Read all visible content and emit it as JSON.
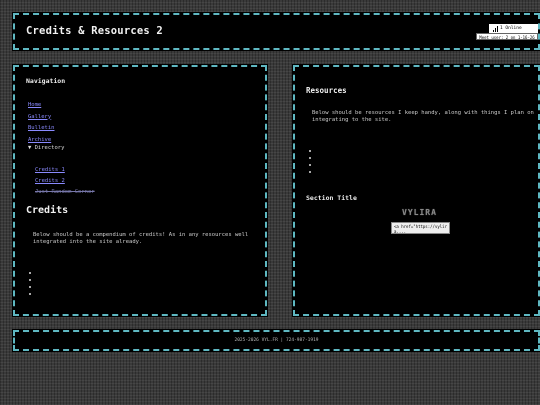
{
  "header": {
    "site_title": "Credits & Resources 2",
    "online_label": "1 Online",
    "meet_label": "Meet user: 2 on 1-16-26"
  },
  "nav": {
    "title": "Navigation",
    "items": [
      {
        "label": "Home"
      },
      {
        "label": "Gallery"
      },
      {
        "label": "Bulletin"
      },
      {
        "label": "Archive"
      }
    ],
    "directory": {
      "label": "▼ Directory",
      "items": [
        {
          "label": "Credits 1"
        },
        {
          "label": "Credits 2"
        },
        {
          "label": "Just Random Corner"
        }
      ]
    }
  },
  "credits": {
    "heading": "Credits",
    "text": "Below should be a compendium of credits! As in any resources well integrated into the site already."
  },
  "resources": {
    "heading": "Resources",
    "text": "Below should be resources I keep handy, along with things I plan on integrating to the site.",
    "section_title": "Section Title",
    "badge_text": "VYLIRA",
    "code_snippet": "<a href=\"https://vylira...."
  },
  "footer": {
    "text": "2025-2026 VYL.FR | 724-987-1919"
  }
}
